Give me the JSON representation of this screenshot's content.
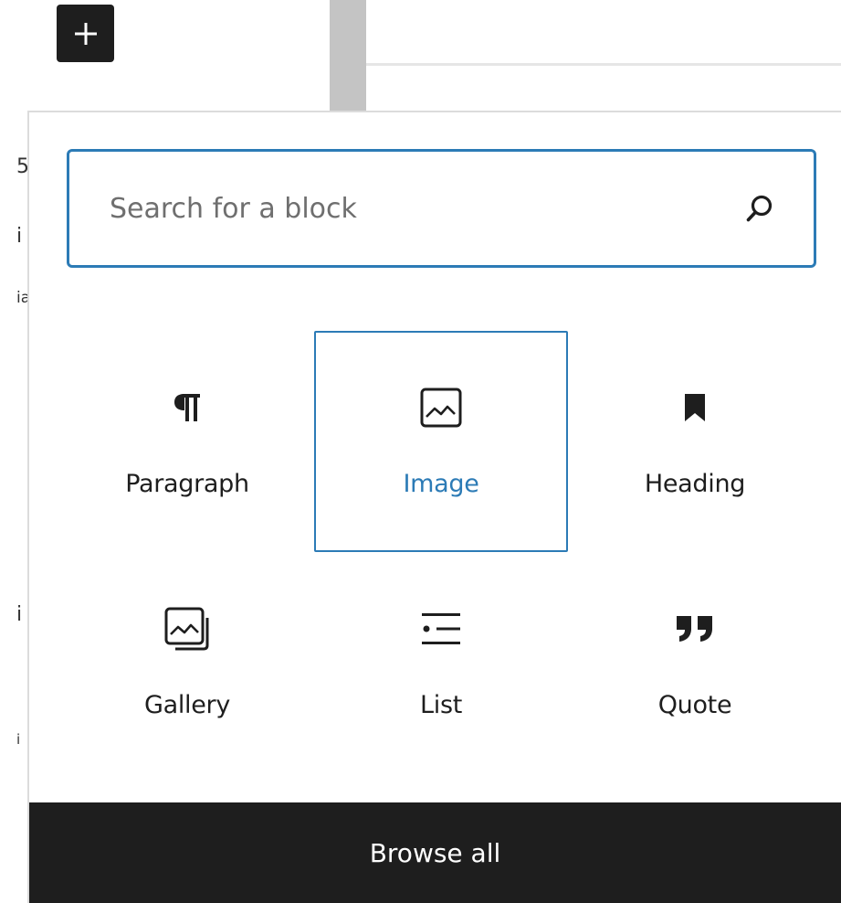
{
  "toolbar": {
    "add_block_icon": "plus-icon"
  },
  "background": {
    "truncated_glyphs": [
      "5",
      "i",
      "ia",
      "i",
      "i"
    ]
  },
  "inserter": {
    "search": {
      "placeholder": "Search for a block",
      "value": "",
      "icon": "search-icon"
    },
    "blocks": [
      {
        "label": "Paragraph",
        "icon": "paragraph-icon",
        "selected": false
      },
      {
        "label": "Image",
        "icon": "image-icon",
        "selected": true
      },
      {
        "label": "Heading",
        "icon": "heading-icon",
        "selected": false
      },
      {
        "label": "Gallery",
        "icon": "gallery-icon",
        "selected": false
      },
      {
        "label": "List",
        "icon": "list-icon",
        "selected": false
      },
      {
        "label": "Quote",
        "icon": "quote-icon",
        "selected": false
      }
    ],
    "browse_all_label": "Browse all"
  },
  "colors": {
    "accent": "#2c7bb6",
    "dark": "#1e1e1e"
  }
}
